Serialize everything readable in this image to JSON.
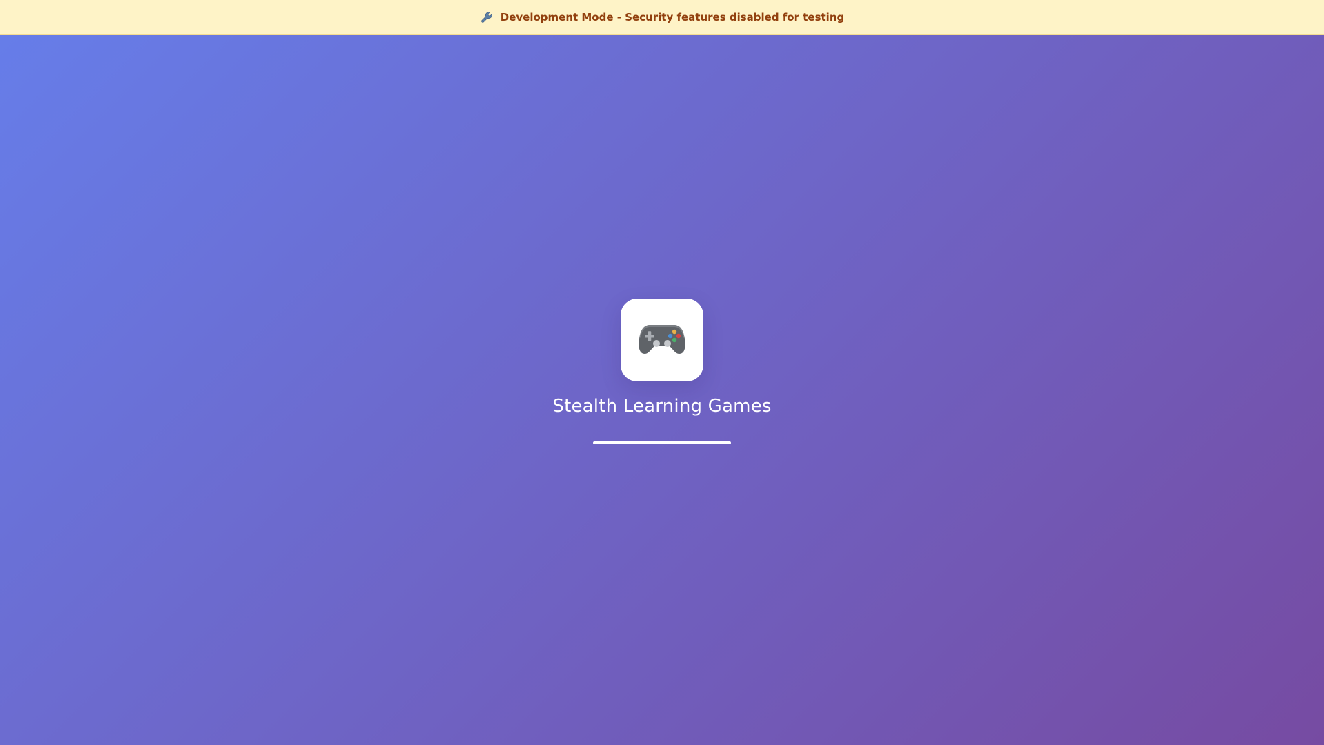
{
  "banner": {
    "icon": "wrench-icon",
    "text": "Development Mode - Security features disabled for testing",
    "background": "#fef3c7",
    "text_color": "#92400e"
  },
  "loader": {
    "logo_icon": "gamepad-icon",
    "title": "Stealth Learning Games",
    "progress": 1.0
  },
  "colors": {
    "gradient_start": "#667eea",
    "gradient_end": "#764ba2"
  }
}
